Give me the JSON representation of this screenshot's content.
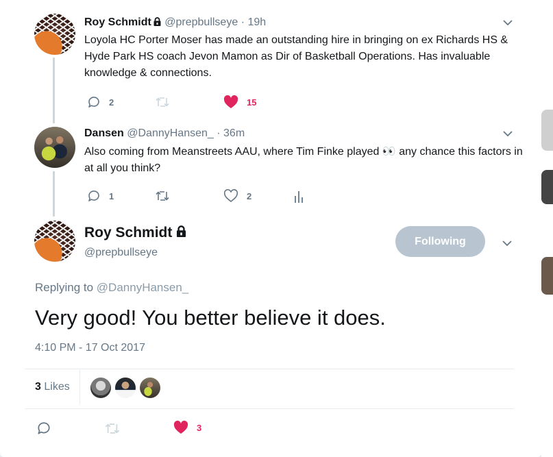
{
  "tweet1": {
    "name": "Roy Schmidt",
    "handle": "@prepbullseye",
    "sep": "·",
    "time": "19h",
    "text": "Loyola HC Porter Moser has made an outstanding hire in bringing on ex Richards HS  & Hyde Park HS coach Jevon Mamon as Dir of Basketball Operations.  Has invaluable knowledge & connections.",
    "replies": "2",
    "likes": "15"
  },
  "tweet2": {
    "name": "Dansen",
    "handle": "@DannyHansen_",
    "sep": "·",
    "time": "36m",
    "text_before": "Also coming from Meanstreets AAU, where Tim Finke played ",
    "emoji": "👀",
    "text_after": " any chance this factors in at all you think?",
    "replies": "1",
    "likes": "2"
  },
  "main": {
    "name": "Roy Schmidt",
    "handle": "@prepbullseye",
    "follow_label": "Following",
    "replying_prefix": "Replying to",
    "replying_handle": "@DannyHansen_",
    "text": "Very good! You better believe it does.",
    "timestamp": "4:10 PM - 17 Oct 2017",
    "likes_count": "3",
    "likes_label": "Likes",
    "action_likes": "3"
  },
  "colors": {
    "heart": "#e0245e",
    "icon_gray": "#657786",
    "follow_bg": "#b8c5d0",
    "link_gray": "#8a9ba8"
  },
  "icons": [
    "lock-icon",
    "reply-icon",
    "retweet-icon",
    "heart-icon",
    "heart-filled-icon",
    "analytics-icon",
    "chevron-down-icon"
  ]
}
